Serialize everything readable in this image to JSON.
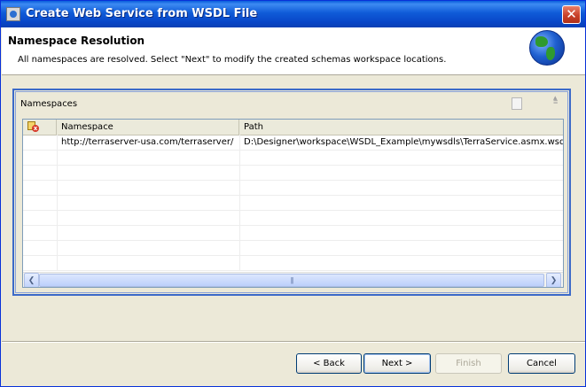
{
  "window": {
    "title": "Create Web Service from WSDL File",
    "close_glyph": "✕"
  },
  "banner": {
    "title": "Namespace Resolution",
    "message": "All namespaces are resolved. Select \"Next\" to modify the created schemas workspace locations.",
    "icon": "globe-icon"
  },
  "section": {
    "label": "Namespaces"
  },
  "table": {
    "columns": [
      "",
      "Namespace",
      "Path"
    ],
    "rows": [
      {
        "namespace": "http://terraserver-usa.com/terraserver/",
        "path": "D:\\Designer\\workspace\\WSDL_Example\\mywsdls\\TerraService.asmx.wsdl"
      }
    ]
  },
  "scrollbar": {
    "left_glyph": "❮",
    "right_glyph": "❯",
    "grip": "|||"
  },
  "buttons": {
    "back": "< Back",
    "next": "Next >",
    "finish": "Finish",
    "cancel": "Cancel"
  },
  "colors": {
    "titlebar": "#0a5ddc",
    "dialog_bg": "#ece9d8",
    "focus_border": "#3c6ac8"
  }
}
